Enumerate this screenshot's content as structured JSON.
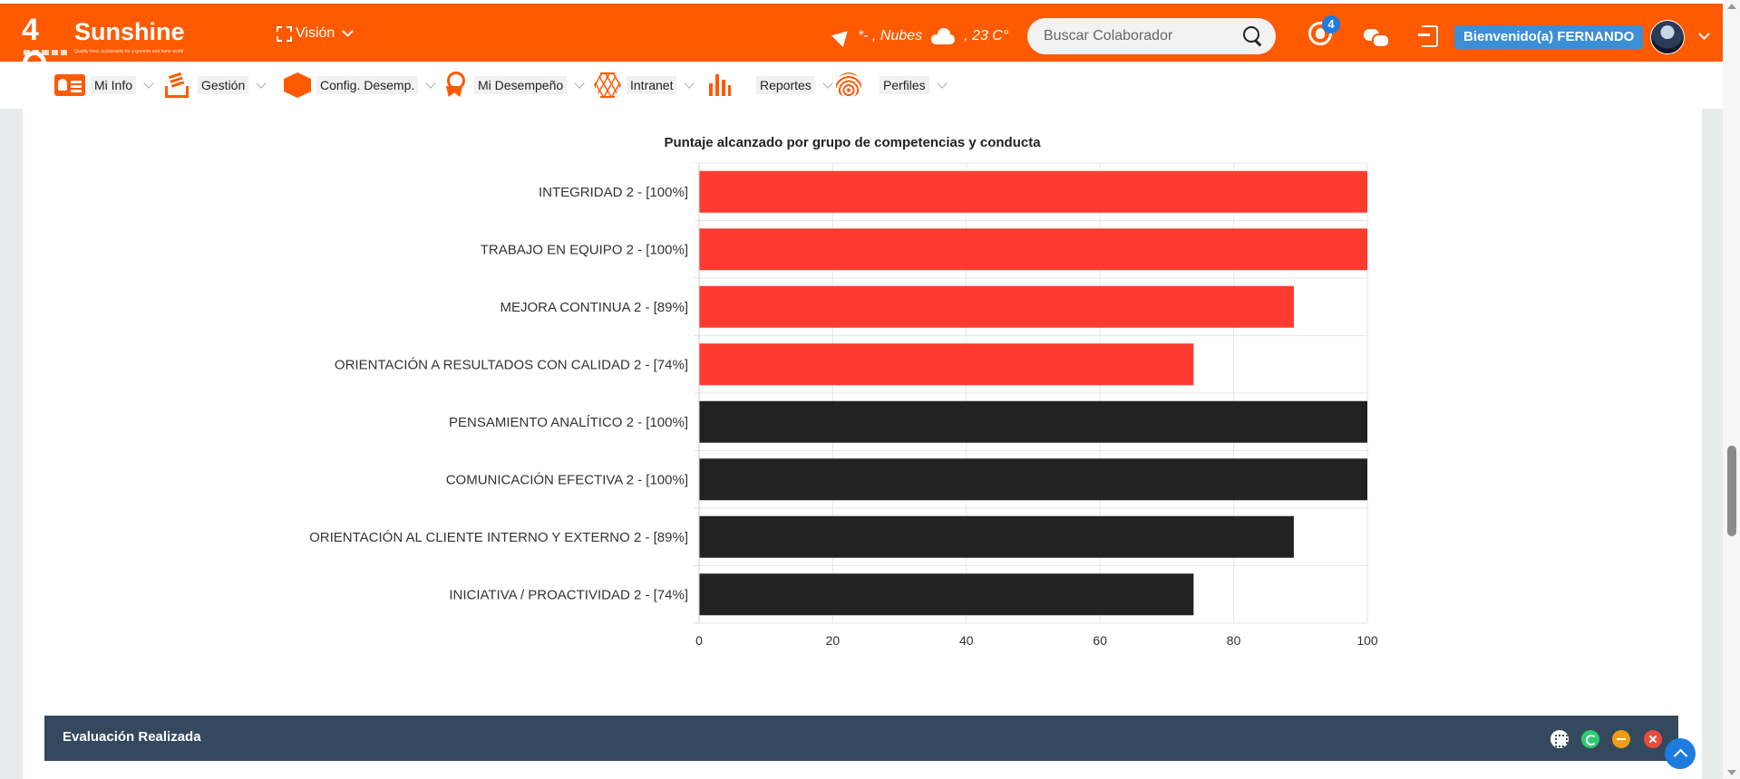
{
  "header": {
    "logo_number": "4",
    "logo_brand": "Sunshine",
    "logo_tagline": "Quality food, sustainably for a greener and fairer world",
    "vision_label": "Visión",
    "weather_text": "*- , Nubes",
    "temperature": ", 23 C°",
    "search_placeholder": "Buscar Colaborador",
    "notification_count": "4",
    "welcome_text": "Bienvenido(a) FERNANDO"
  },
  "menu": {
    "items": [
      {
        "label": "Mi Info"
      },
      {
        "label": "Gestión"
      },
      {
        "label": "Config. Desemp."
      },
      {
        "label": "Mi Desempeño"
      },
      {
        "label": "Intranet"
      },
      {
        "label": "Reportes"
      },
      {
        "label": "Perfiles"
      }
    ]
  },
  "colors": {
    "brand_orange": "#ff5a00",
    "series_red": "#ff3b30",
    "series_dark": "#222222",
    "panel_header": "#34495e"
  },
  "chart_data": {
    "type": "bar",
    "orientation": "horizontal",
    "title": "Puntaje alcanzado por grupo de competencias y conducta",
    "categories": [
      "INTEGRIDAD 2 - [100%]",
      "TRABAJO EN EQUIPO 2 - [100%]",
      "MEJORA CONTINUA 2 - [89%]",
      "ORIENTACIÓN A RESULTADOS CON CALIDAD 2 - [74%]",
      "PENSAMIENTO ANALÍTICO 2 - [100%]",
      "COMUNICACIÓN EFECTIVA 2 - [100%]",
      "ORIENTACIÓN AL CLIENTE INTERNO Y EXTERNO 2 - [89%]",
      "INICIATIVA / PROACTIVIDAD 2 - [74%]"
    ],
    "values": [
      100,
      100,
      89,
      74,
      100,
      100,
      89,
      74
    ],
    "bar_colors": [
      "#ff3b30",
      "#ff3b30",
      "#ff3b30",
      "#ff3b30",
      "#222222",
      "#222222",
      "#222222",
      "#222222"
    ],
    "xlim": [
      0,
      100
    ],
    "xticks": [
      "0",
      "20",
      "40",
      "60",
      "80",
      "100"
    ],
    "grid": true,
    "xlabel": "",
    "ylabel": ""
  },
  "panel": {
    "title": "Evaluación Realizada"
  }
}
